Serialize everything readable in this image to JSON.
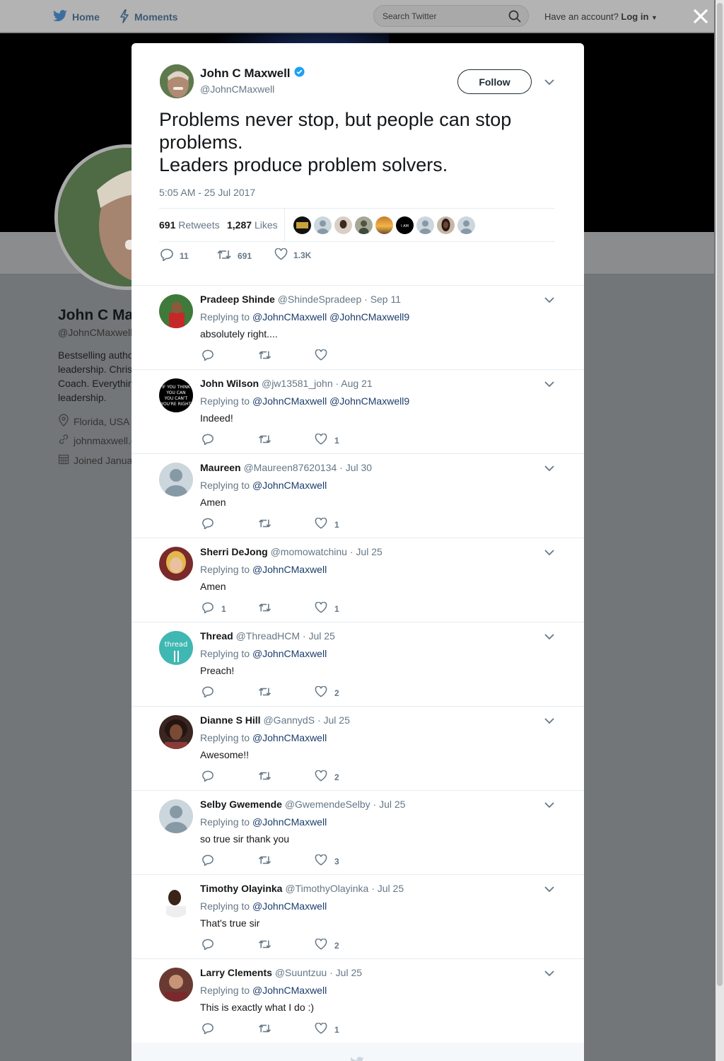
{
  "nav": {
    "home": "Home",
    "moments": "Moments",
    "search_placeholder": "Search Twitter",
    "account_prompt": "Have an account?",
    "login": "Log in"
  },
  "background_profile": {
    "name": "John C Ma",
    "handle": "@JohnCMaxwell",
    "bio_lines": [
      "Bestselling autho",
      "leadership. Chris",
      "Coach. Everythin",
      "leadership."
    ],
    "location": "Florida, USA",
    "website": "johnmaxwell.c",
    "joined": "Joined Janua"
  },
  "tweet": {
    "author_name": "John C Maxwell",
    "author_handle": "@JohnCMaxwell",
    "verified": true,
    "follow_label": "Follow",
    "text_lines": [
      "Problems never stop, but people can stop",
      "problems.",
      "Leaders produce problem solvers."
    ],
    "timestamp": "5:05 AM - 25 Jul 2017",
    "retweets_count": "691",
    "retweets_label": "Retweets",
    "likes_count": "1,287",
    "likes_label": "Likes",
    "reply_count": "11",
    "retweet_action_count": "691",
    "like_action_count": "1.3K",
    "accent": "#1da1f2"
  },
  "replies": [
    {
      "name": "Pradeep Shinde",
      "handle": "@ShindeSpradeep",
      "date": "Sep 11",
      "replying_prefix": "Replying to",
      "replying_to": "@JohnCMaxwell @JohnCMaxwell9",
      "text": "absolutely right....",
      "reply_count": "",
      "like_count": ""
    },
    {
      "name": "John Wilson",
      "handle": "@jw13581_john",
      "date": "Aug 21",
      "replying_prefix": "Replying to",
      "replying_to": "@JohnCMaxwell @JohnCMaxwell9",
      "text": "Indeed!",
      "reply_count": "",
      "like_count": "1"
    },
    {
      "name": "Maureen",
      "handle": "@Maureen87620134",
      "date": "Jul 30",
      "replying_prefix": "Replying to",
      "replying_to": "@JohnCMaxwell",
      "text": "Amen",
      "reply_count": "",
      "like_count": "1"
    },
    {
      "name": "Sherri DeJong",
      "handle": "@momowatchinu",
      "date": "Jul 25",
      "replying_prefix": "Replying to",
      "replying_to": "@JohnCMaxwell",
      "text": "Amen",
      "reply_count": "1",
      "like_count": "1"
    },
    {
      "name": "Thread",
      "handle": "@ThreadHCM",
      "date": "Jul 25",
      "replying_prefix": "Replying to",
      "replying_to": "@JohnCMaxwell",
      "text": "Preach!",
      "reply_count": "",
      "like_count": "2"
    },
    {
      "name": "Dianne S Hill",
      "handle": "@GannydS",
      "date": "Jul 25",
      "replying_prefix": "Replying to",
      "replying_to": "@JohnCMaxwell",
      "text": "Awesome!!",
      "reply_count": "",
      "like_count": "2"
    },
    {
      "name": "Selby Gwemende",
      "handle": "@GwemendeSelby",
      "date": "Jul 25",
      "replying_prefix": "Replying to",
      "replying_to": "@JohnCMaxwell",
      "text": "so true sir thank you",
      "reply_count": "",
      "like_count": "3"
    },
    {
      "name": "Timothy Olayinka",
      "handle": "@TimothyOlayinka",
      "date": "Jul 25",
      "replying_prefix": "Replying to",
      "replying_to": "@JohnCMaxwell",
      "text": "That's true sir",
      "reply_count": "",
      "like_count": "2"
    },
    {
      "name": "Larry Clements",
      "handle": "@Suuntzuu",
      "date": "Jul 25",
      "replying_prefix": "Replying to",
      "replying_to": "@JohnCMaxwell",
      "text": "This is exactly what I do :)",
      "reply_count": "",
      "like_count": "1"
    }
  ],
  "icons": {
    "nav_home": "twitter-bird-icon",
    "nav_moments": "lightning-icon",
    "search": "search-icon",
    "close": "close-icon",
    "verified": "verified-badge-icon",
    "reply": "reply-icon",
    "retweet": "retweet-icon",
    "like": "heart-icon",
    "more": "chevron-down-icon"
  }
}
